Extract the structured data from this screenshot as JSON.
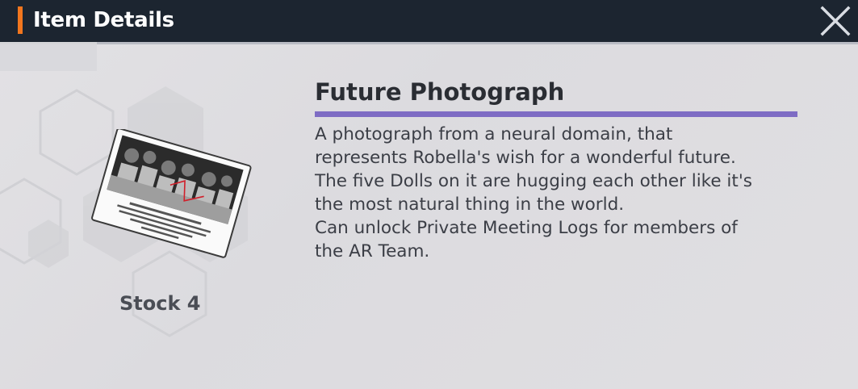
{
  "header": {
    "title": "Item Details",
    "accent_color": "#f2761e",
    "close_icon": "close-icon"
  },
  "item": {
    "name": "Future Photograph",
    "name_underline_color": "#7e6cc4",
    "image_icon": "photograph-icon",
    "stock_label": "Stock 4",
    "description_lines": [
      "A photograph from a neural domain, that",
      "represents Robella's wish for a wonderful future.",
      "The five Dolls on it are hugging each other like it's",
      "the most natural thing in the world.",
      "Can unlock Private Meeting Logs for members of",
      "the AR Team."
    ]
  }
}
